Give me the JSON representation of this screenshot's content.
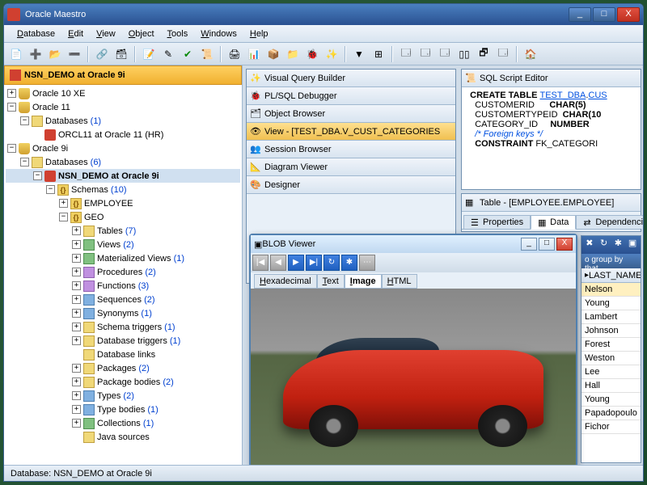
{
  "window": {
    "title": "Oracle Maestro"
  },
  "menu": {
    "database": "Database",
    "edit": "Edit",
    "view": "View",
    "object": "Object",
    "tools": "Tools",
    "windows": "Windows",
    "help": "Help"
  },
  "db_header": "NSN_DEMO at Oracle 9i",
  "tree": {
    "oracle10xe": "Oracle 10 XE",
    "oracle11": "Oracle 11",
    "databases1": "Databases",
    "databases1_cnt": "(1)",
    "orcl11": "ORCL11 at Oracle 11 (HR)",
    "oracle9i": "Oracle 9i",
    "databases6": "Databases",
    "databases6_cnt": "(6)",
    "nsndemo": "NSN_DEMO at Oracle 9i",
    "schemas": "Schemas",
    "schemas_cnt": "(10)",
    "employee": "EMPLOYEE",
    "geo": "GEO",
    "tables": "Tables",
    "tables_cnt": "(7)",
    "views": "Views",
    "views_cnt": "(2)",
    "matviews": "Materialized Views",
    "matviews_cnt": "(1)",
    "procs": "Procedures",
    "procs_cnt": "(2)",
    "funcs": "Functions",
    "funcs_cnt": "(3)",
    "seqs": "Sequences",
    "seqs_cnt": "(2)",
    "syns": "Synonyms",
    "syns_cnt": "(1)",
    "strig": "Schema triggers",
    "strig_cnt": "(1)",
    "dtrig": "Database triggers",
    "dtrig_cnt": "(1)",
    "dblinks": "Database links",
    "pkgs": "Packages",
    "pkgs_cnt": "(2)",
    "pkgbod": "Package bodies",
    "pkgbod_cnt": "(2)",
    "types": "Types",
    "types_cnt": "(2)",
    "typebod": "Type bodies",
    "typebod_cnt": "(1)",
    "colls": "Collections",
    "colls_cnt": "(1)",
    "javasrc": "Java sources"
  },
  "panels": {
    "vqb": "Visual Query Builder",
    "plsql": "PL/SQL Debugger",
    "objbrowser": "Object Browser",
    "view": "View - [TEST_DBA.V_CUST_CATEGORIES",
    "session": "Session Browser",
    "diagram": "Diagram Viewer",
    "designer": "Designer",
    "sqlscript": "SQL Script Editor",
    "table": "Table - [EMPLOYEE.EMPLOYEE]"
  },
  "sql": {
    "l1a": "CREATE TABLE ",
    "l1b": "TEST_DBA",
    "l1c": ".",
    "l1d": "CUS",
    "l2a": "CUSTOMERID",
    "l2b": "CHAR(5)",
    "l3a": "CUSTOMERTYPEID",
    "l3b": "CHAR(10",
    "l4a": "CATEGORY_ID",
    "l4b": "NUMBER",
    "l5": "/* Foreign keys */",
    "l6a": "CONSTRAINT ",
    "l6b": "FK_CATEGORI"
  },
  "tabletabs": {
    "properties": "Properties",
    "data": "Data",
    "deps": "Dependenci"
  },
  "blob": {
    "title": "BLOB Viewer",
    "tabs": {
      "hex": "Hexadecimal",
      "text": "Text",
      "image": "Image",
      "html": "HTML"
    }
  },
  "grid": {
    "grouphint": "o group by that",
    "colheader": "LAST_NAME",
    "rows": [
      "Nelson",
      "Young",
      "Lambert",
      "Johnson",
      "Forest",
      "Weston",
      "Lee",
      "Hall",
      "Young",
      "Papadopoulo",
      "Fichor"
    ]
  },
  "statusbar": "Database: NSN_DEMO at Oracle 9i"
}
